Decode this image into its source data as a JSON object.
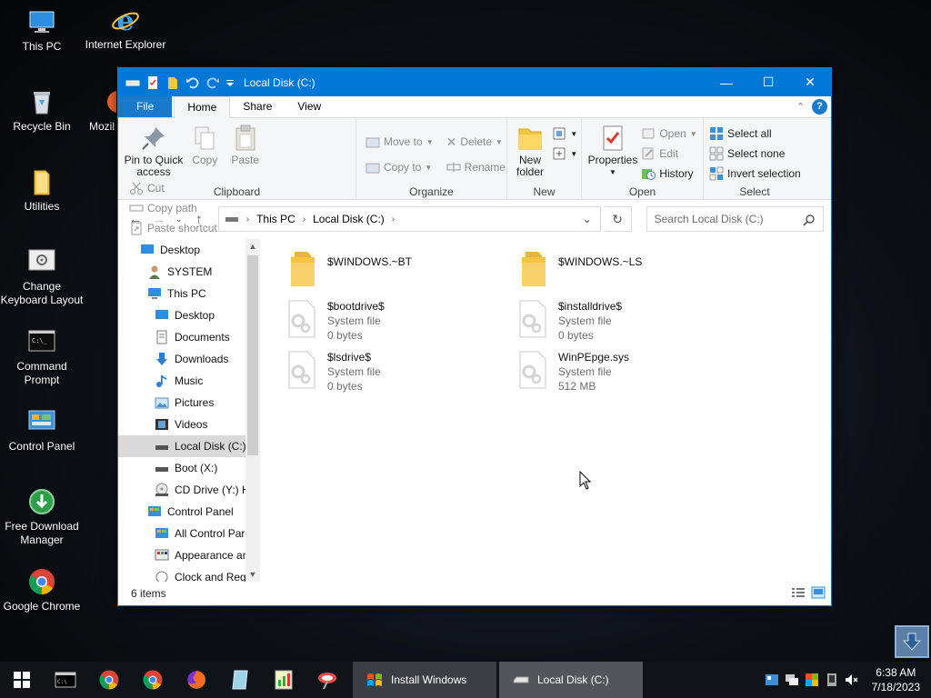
{
  "desktop": {
    "icons": [
      {
        "label": "This PC"
      },
      {
        "label": "Internet Explorer"
      },
      {
        "label": "Recycle Bin"
      },
      {
        "label": "Mozil"
      },
      {
        "label": "Utilities"
      },
      {
        "label": "Change Keyboard Layout"
      },
      {
        "label": "Command Prompt"
      },
      {
        "label": "Control Panel"
      },
      {
        "label": "Free Download Manager"
      },
      {
        "label": "Google Chrome"
      }
    ]
  },
  "window": {
    "title": "Local Disk (C:)",
    "tabs": {
      "file": "File",
      "home": "Home",
      "share": "Share",
      "view": "View"
    },
    "help": "?",
    "ribbon": {
      "clipboard": {
        "label": "Clipboard",
        "pin": "Pin to Quick access",
        "copy": "Copy",
        "paste": "Paste",
        "cut": "Cut",
        "copy_path": "Copy path",
        "paste_shortcut": "Paste shortcut"
      },
      "organize": {
        "label": "Organize",
        "move_to": "Move to",
        "copy_to": "Copy to",
        "delete": "Delete",
        "rename": "Rename"
      },
      "new": {
        "label": "New",
        "new_folder": "New folder"
      },
      "open": {
        "label": "Open",
        "properties": "Properties",
        "open": "Open",
        "edit": "Edit",
        "history": "History"
      },
      "select": {
        "label": "Select",
        "select_all": "Select all",
        "select_none": "Select none",
        "invert": "Invert selection"
      }
    },
    "address": {
      "crumbs": [
        "This PC",
        "Local Disk (C:)"
      ],
      "search_placeholder": "Search Local Disk (C:)"
    },
    "nav": [
      {
        "label": "Desktop",
        "indent": 0
      },
      {
        "label": "SYSTEM",
        "indent": 1
      },
      {
        "label": "This PC",
        "indent": 1
      },
      {
        "label": "Desktop",
        "indent": 2
      },
      {
        "label": "Documents",
        "indent": 2
      },
      {
        "label": "Downloads",
        "indent": 2
      },
      {
        "label": "Music",
        "indent": 2
      },
      {
        "label": "Pictures",
        "indent": 2
      },
      {
        "label": "Videos",
        "indent": 2
      },
      {
        "label": "Local Disk (C:)",
        "indent": 2
      },
      {
        "label": "Boot (X:)",
        "indent": 2
      },
      {
        "label": "CD Drive (Y:) H",
        "indent": 2
      },
      {
        "label": "Control Panel",
        "indent": 1
      },
      {
        "label": "All Control Par",
        "indent": 2
      },
      {
        "label": "Appearance an",
        "indent": 2
      },
      {
        "label": "Clock and Regi",
        "indent": 2
      }
    ],
    "files": [
      {
        "name": "$WINDOWS.~BT",
        "type": "",
        "size": ""
      },
      {
        "name": "$WINDOWS.~LS",
        "type": "",
        "size": ""
      },
      {
        "name": "$bootdrive$",
        "type": "System file",
        "size": "0 bytes"
      },
      {
        "name": "$installdrive$",
        "type": "System file",
        "size": "0 bytes"
      },
      {
        "name": "$lsdrive$",
        "type": "System file",
        "size": "0 bytes"
      },
      {
        "name": "WinPEpge.sys",
        "type": "System file",
        "size": "512 MB"
      }
    ],
    "status": "6 items"
  },
  "taskbar": {
    "apps": [
      {
        "label": "Install Windows"
      },
      {
        "label": "Local Disk (C:)"
      }
    ],
    "time": "6:38 AM",
    "date": "7/18/2023"
  },
  "colors": {
    "accent": "#0078d7",
    "folder": "#f4c542",
    "selected": "#cce8ff"
  }
}
